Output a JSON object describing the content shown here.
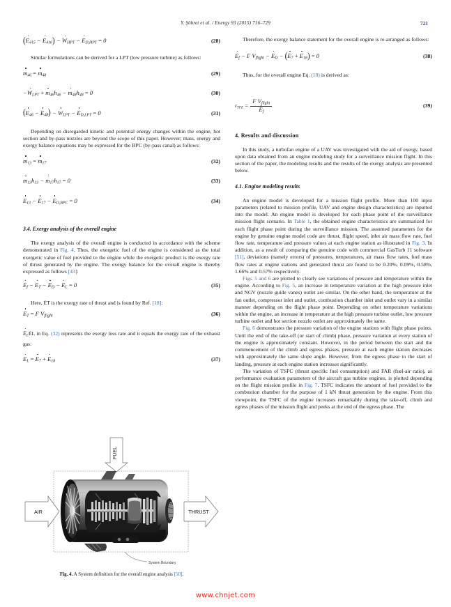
{
  "header": {
    "citation": "Y. Şöhret et al. / Energy 93 (2015) 716–729",
    "page_number": "721"
  },
  "left_column": {
    "eq28": {
      "body": "(Ė415 − Ė416) − ẆHPT − ĖD,HPT = 0",
      "number": "(28)"
    },
    "p1": "Similar formulations can be derived for a LPT (low pressure turbine) as follows:",
    "eq29": {
      "body": "ṁ46 = ṁ48",
      "number": "(29)"
    },
    "eq30": {
      "body": "−ẆLPT + ṁ46h46 − ṁ48h48 = 0",
      "number": "(30)"
    },
    "eq31": {
      "body": "(Ė46 − Ė48) − ẆLPT − ĖD,LPT = 0",
      "number": "(31)"
    },
    "p2": "Depending on disregarded kinetic and potential energy changes within the engine, hot section and by-pass nozzles are beyond the scope of this paper. However; mass, energy and exergy balance equations may be expressed for the BPC (by-pass canal) as follows:",
    "eq32": {
      "body": "ṁ13 = ṁ17",
      "number": "(32)"
    },
    "eq33": {
      "body": "ṁ13h13 − ṁ17h17 = 0",
      "number": "(33)"
    },
    "eq34": {
      "body": "Ė13 − Ė17 − ĖD,BPC = 0",
      "number": "(34)"
    },
    "subsec34": "3.4.  Exergy analysis of the overall engine",
    "p3_a": "The exergy analysis of the overall engine is conducted in accordance with the scheme demonstrated in ",
    "p3_ref1": "Fig. 4",
    "p3_b": ". Thus, the exergetic fuel of the engine is considered as the total exergetic value of fuel provided to the engine while the exergetic product is the exergy rate of thrust generated by the engine. The exergy balance for the overall engine is thereby expressed as follows ",
    "p3_ref2": "[43]",
    "p3_c": ":",
    "eq35": {
      "body": "Ėf − ĖT − ĖD − ĖL = 0",
      "number": "(35)"
    },
    "p4_a": "Here, ĖT is the exergy rate of thrust and is found by Ref. ",
    "p4_ref": "[18]",
    "p4_b": ":",
    "eq36": {
      "body": "ĖT = F Vflight",
      "number": "(36)"
    },
    "p5_a": "ĖL in Eq. ",
    "p5_ref": "(32)",
    "p5_b": " represents the exergy loss rate and it equals the exergy rate of the exhaust gas:",
    "eq37": {
      "body": "ĖL = Ė7 + Ė18",
      "number": "(37)"
    }
  },
  "right_column": {
    "p1": "Therefore, the exergy balance statement for the overall engine is re-arranged as follows:",
    "eq38": {
      "body": "Ėf − F Vflight − ĖD − (Ė7 + Ė18) = 0",
      "number": "(38)"
    },
    "p2_a": "Thus, for the overall engine Eq. ",
    "p2_ref": "(10)",
    "p2_b": " is derived as:",
    "eq39": {
      "body": "εTFE = F Vflight / Ėf",
      "number": "(39)"
    },
    "sec4": "4.  Results and discussion",
    "p3": "In this study, a turbofan engine of a UAV was investigated with the aid of exergy, based upon data obtained from an engine modeling study for a surveillance mission flight. In this section of the paper, the modeling results and the results of the exergy analysis are presented below.",
    "subsec41": "4.1.  Engine modeling results",
    "p4_a": "An engine model is developed for a mission flight profile. More than 100 input parameters (related to mission profile, UAV and engine design characteristics) are inputted into the model. An engine model is developed for each phase point of the surveillance mission flight scenario. In ",
    "p4_ref1": "Table 1",
    "p4_b": ", the obtained engine characteristics are summarized for each flight phase point during the surveillance mission. The assumed parameters for the engine by genuine engine model code are thrust, flight speed, inlet air mass flow rate, fuel flow rate, temperature and pressure values at each engine station as illustrated in ",
    "p4_ref2": "Fig. 3",
    "p4_c": ". In addition, as a result of comparing the genuine code with commercial GasTurb 11 software ",
    "p4_ref3": "[51]",
    "p4_d": ", deviations (namely errors) of pressures, temperatures, air mass flow rates, fuel mass flow rates at engine stations and generated thrust are found to be 0.20%, 0.09%, 0.58%, 1.66% and 0.57% respectively.",
    "p5_ref1": "Figs. 5 and 6",
    "p5_a": " are plotted to clearly see variations of pressure and temperature within the engine. According to ",
    "p5_ref2": "Fig. 5",
    "p5_b": ", an increase in temperature variation at the high pressure inlet and NGV (nozzle guide vanes) outlet are similar. On the other hand, the temperature at the fan outlet, compressor inlet and outlet, combustion chamber inlet and outlet vary in a similar manner depending on the flight phase point. Depending on other temperature variations within the engine, an increase in temperature at the high pressure turbine outlet, low pressure turbine outlet and hot section nozzle outlet are approximately the same.",
    "p6_ref": "Fig. 6",
    "p6_a": " demonstrates the pressure variation of the engine stations with flight phase points. Until the end of the take-off (or start of climb) phase, pressure variation at every station of the engine is approximately constant. However, in the period between the start and the commencement of the climb and egress phases, pressure at each engine station decreases with approximately the same slope angle. However, from the egress phase to the start of landing, pressure at each engine station increases significantly.",
    "p7_a": "The variation of TSFC (thrust specific fuel consumption) and FAR (fuel-air ratio), as performance evaluation parameters of the aircraft gas turbine engines, is plotted depending on the flight mission profile in ",
    "p7_ref": "Fig. 7",
    "p7_b": ". TSFC indicates the amount of fuel provided to the combustion chamber for the purpose of 1 kN thrust generation by the engine. From this viewpoint, the TSFC of the engine increases remarkably during the take-off, climb and egress phases of the mission flight and peeks at the end of the egress phase. The"
  },
  "figure": {
    "label_air": "AIR",
    "label_fuel": "FUEL",
    "label_thrust": "THRUST",
    "label_boundary": "System Boundary",
    "caption_prefix": "Fig. 4.",
    "caption_text": " A System definition for the overall engine analysis ",
    "caption_ref": "[50]",
    "caption_suffix": "."
  },
  "watermark": {
    "text": "www.chnjet.com",
    "color": "#e8241b"
  },
  "colors": {
    "link": "#3e6fa8",
    "text": "#1a1a1a",
    "watermark": "#e8241b"
  }
}
